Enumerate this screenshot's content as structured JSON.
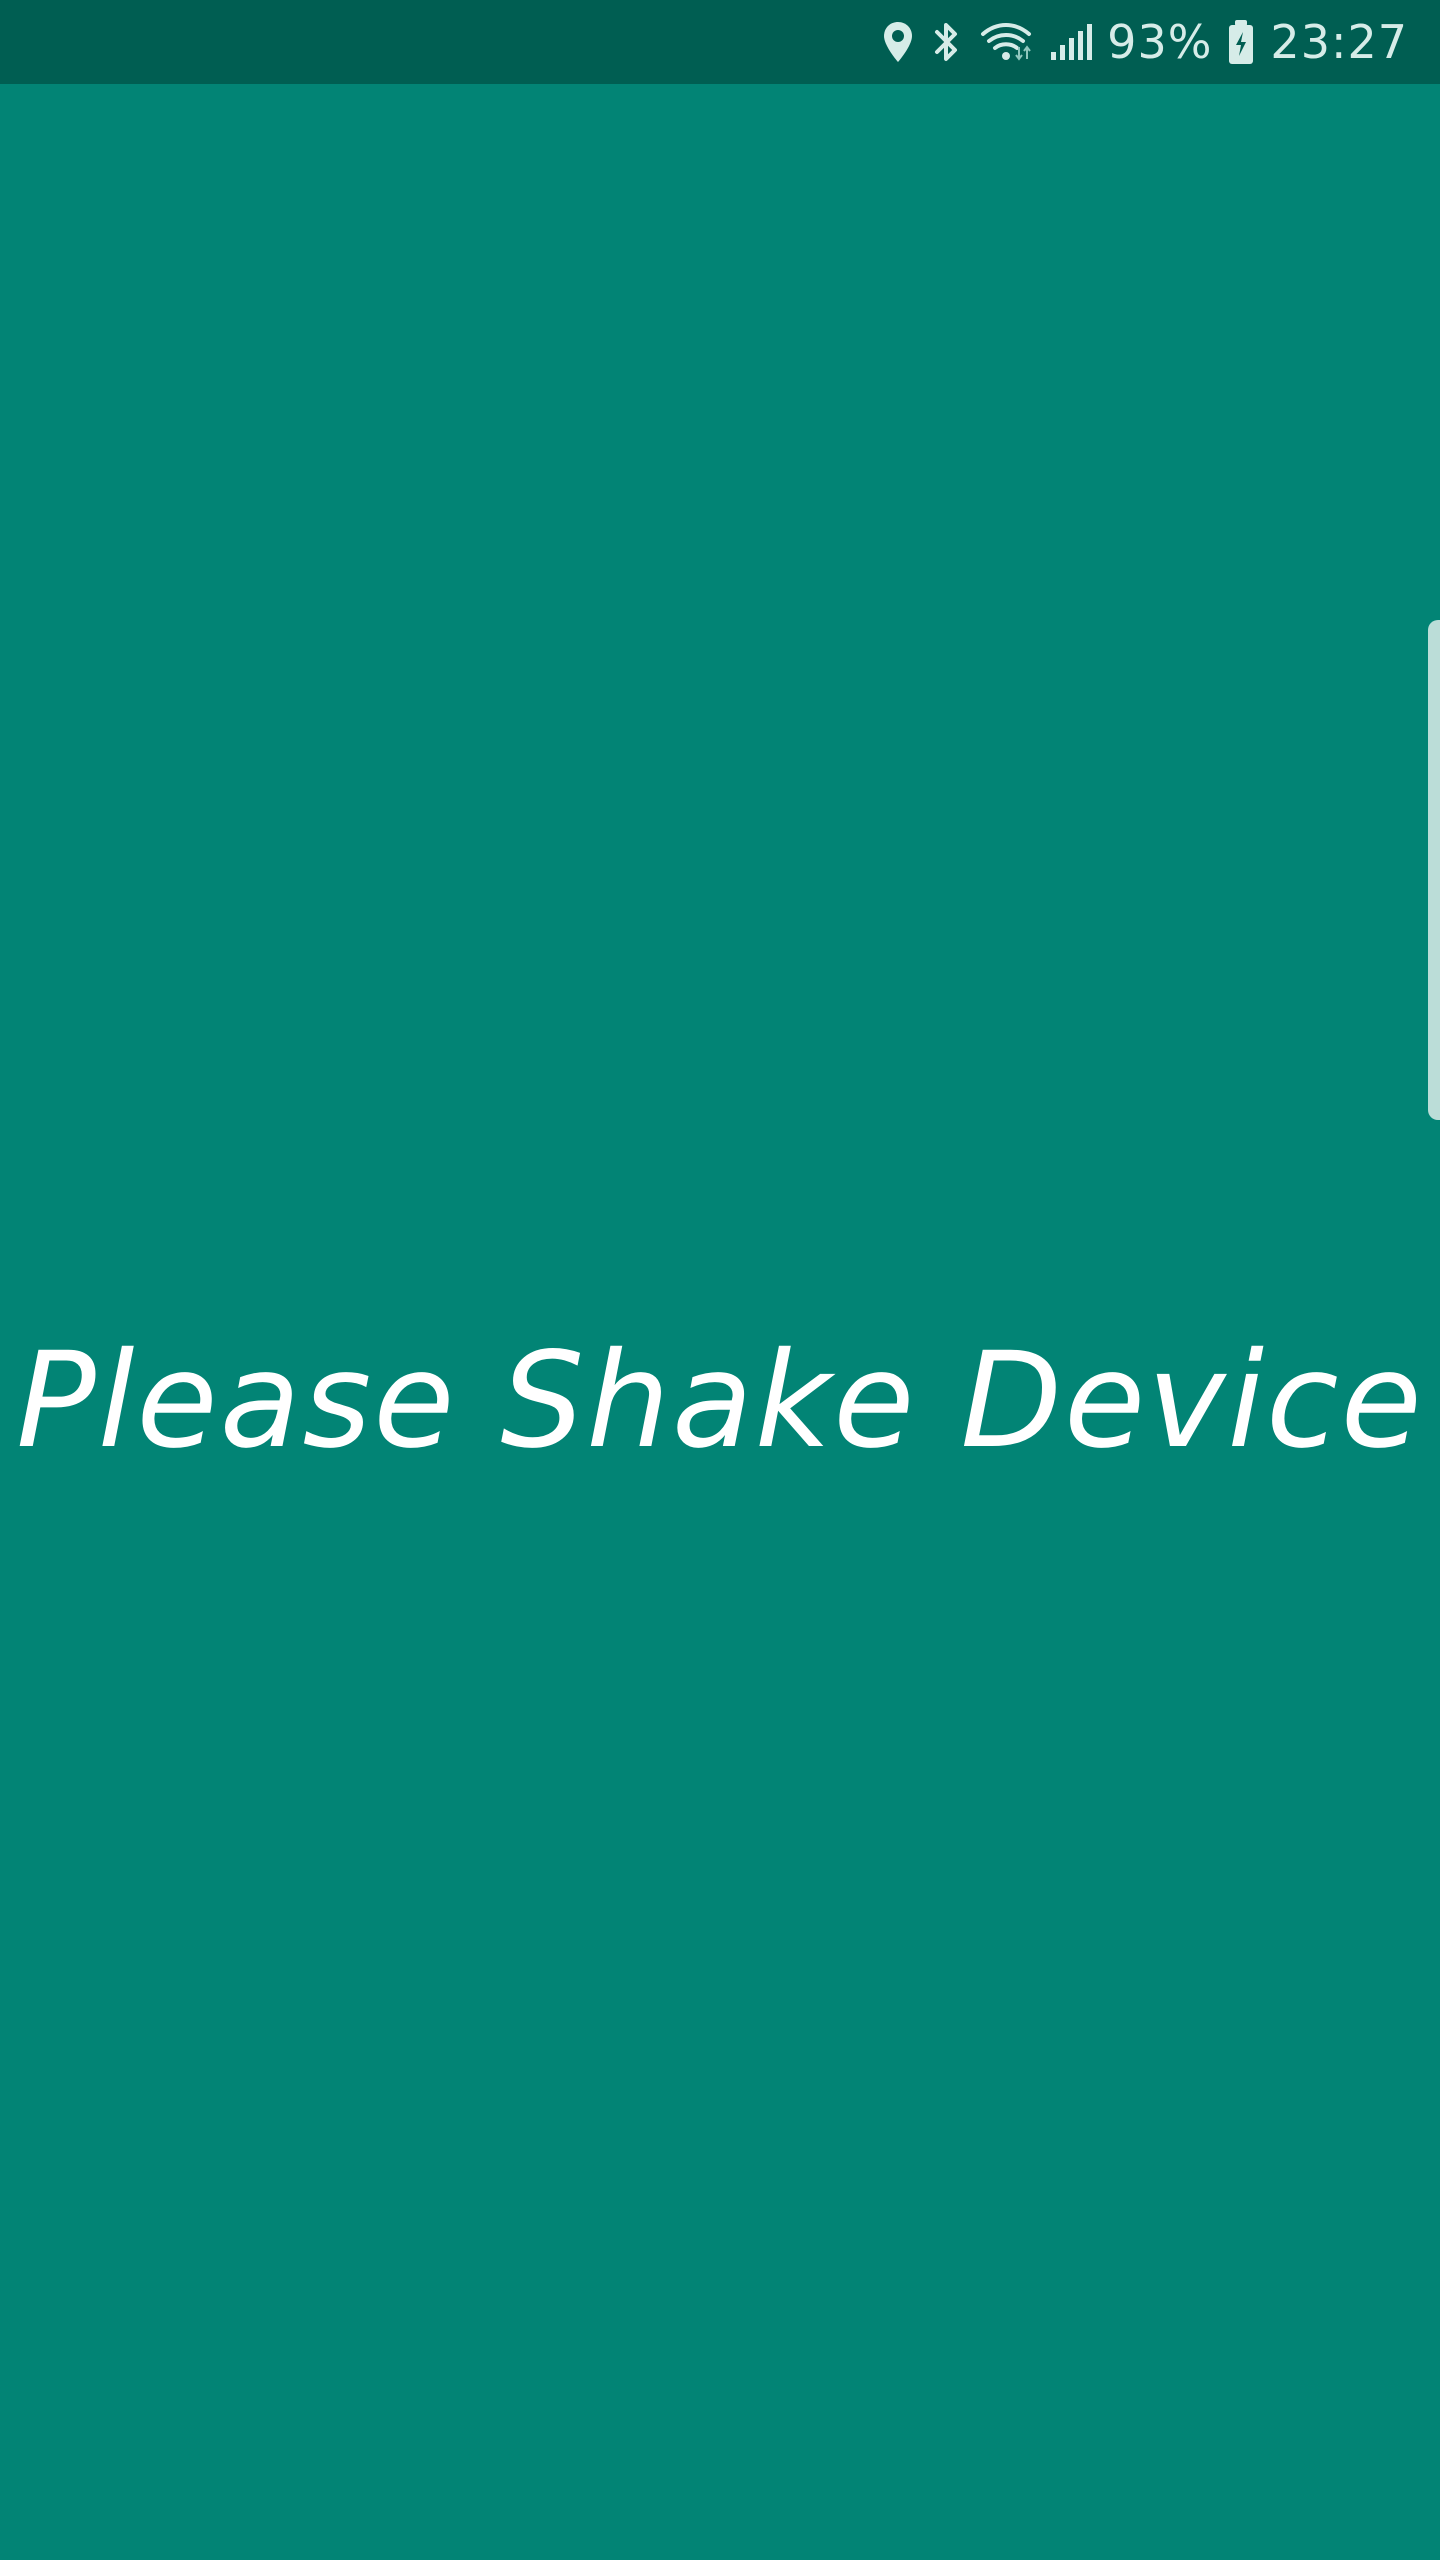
{
  "status_bar": {
    "icons": [
      "location-icon",
      "bluetooth-icon",
      "wifi-icon",
      "signal-icon",
      "battery-charging-icon"
    ],
    "battery_percent": "93%",
    "time": "23:27"
  },
  "main": {
    "message": "Please Shake Device"
  },
  "colors": {
    "background": "#028475",
    "status_bar": "#005e52",
    "text": "#ffffff"
  }
}
